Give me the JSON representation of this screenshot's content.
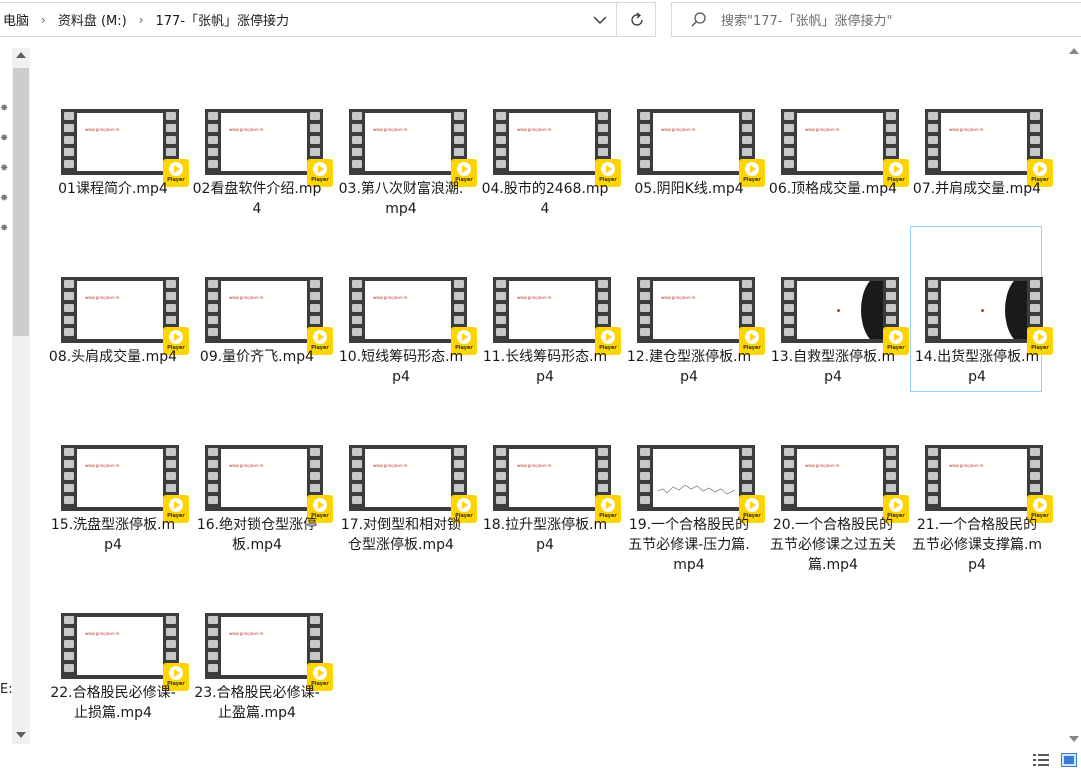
{
  "address": {
    "crumbs": [
      "电脑",
      "资料盘 (M:)",
      "177-「张帆」涨停接力"
    ]
  },
  "search": {
    "placeholder": "搜索\"177-「张帆」涨停接力\""
  },
  "left_stub": {
    "drive_letter": "E:"
  },
  "thumb_url_text": "www.gonipaier.m",
  "badge_text": "Player",
  "files": [
    {
      "name": "01课程简介.mp4",
      "frame": "plain"
    },
    {
      "name": "02看盘软件介绍.mp4",
      "frame": "plain"
    },
    {
      "name": "03.第八次财富浪潮.mp4",
      "frame": "plain"
    },
    {
      "name": "04.股市的2468.mp4",
      "frame": "plain"
    },
    {
      "name": "05.阴阳K线.mp4",
      "frame": "plain"
    },
    {
      "name": "06.顶格成交量.mp4",
      "frame": "plain"
    },
    {
      "name": "07.并肩成交量.mp4",
      "frame": "plain"
    },
    {
      "name": "08.头肩成交量.mp4",
      "frame": "plain"
    },
    {
      "name": "09.量价齐飞.mp4",
      "frame": "plain"
    },
    {
      "name": "10.短线筹码形态.mp4",
      "frame": "plain"
    },
    {
      "name": "11.长线筹码形态.mp4",
      "frame": "plain"
    },
    {
      "name": "12.建仓型涨停板.mp4",
      "frame": "plain"
    },
    {
      "name": "13.自救型涨停板.mp4",
      "frame": "dark-right"
    },
    {
      "name": "14.出货型涨停板.mp4",
      "frame": "dark-right"
    },
    {
      "name": "15.洗盘型涨停板.mp4",
      "frame": "plain"
    },
    {
      "name": "16.绝对锁仓型涨停板.mp4",
      "frame": "plain"
    },
    {
      "name": "17.对倒型和相对锁仓型涨停板.mp4",
      "frame": "plain"
    },
    {
      "name": "18.拉升型涨停板.mp4",
      "frame": "plain"
    },
    {
      "name": "19.一个合格股民的五节必修课-压力篇.mp4",
      "frame": "chart"
    },
    {
      "name": "20.一个合格股民的五节必修课之过五关篇.mp4",
      "frame": "plain"
    },
    {
      "name": "21.一个合格股民的五节必修课支撑篇.mp4",
      "frame": "plain"
    },
    {
      "name": "22.合格股民必修课-止损篇.mp4",
      "frame": "plain"
    },
    {
      "name": "23.合格股民必修课-止盈篇.mp4",
      "frame": "plain"
    }
  ],
  "selected_index": 13
}
